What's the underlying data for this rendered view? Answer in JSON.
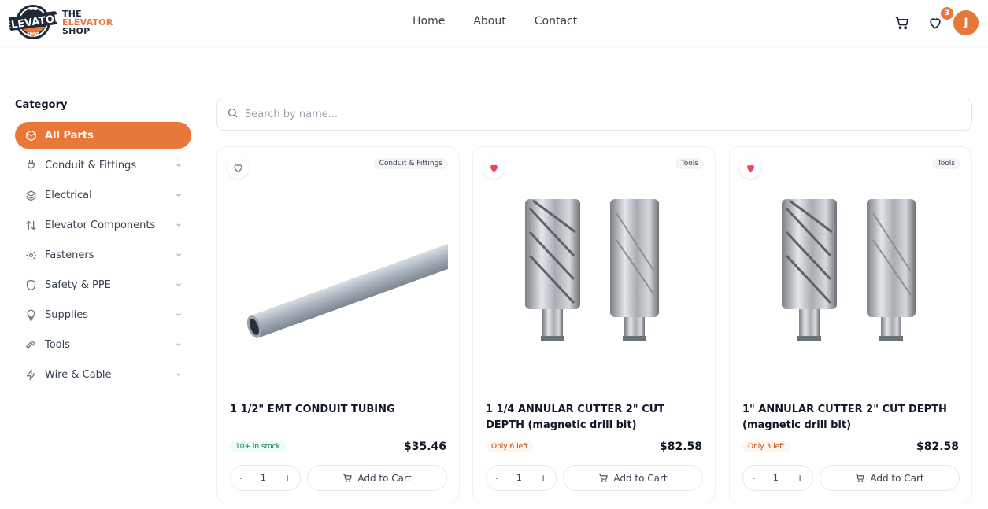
{
  "brand": {
    "line1": "THE",
    "line2": "ELEVATOR",
    "line3": "SHOP",
    "badge_text": "ELEVATOR",
    "badge_small_top": "THE",
    "badge_small_bottom": "SHOP",
    "accent": "#e8773a"
  },
  "nav": {
    "home": "Home",
    "about": "About",
    "contact": "Contact"
  },
  "header": {
    "wishlist_count": "3",
    "avatar_initial": "J"
  },
  "sidebar": {
    "title": "Category",
    "items": [
      {
        "label": "All Parts",
        "icon": "box-icon",
        "active": true
      },
      {
        "label": "Conduit & Fittings",
        "icon": "plug-icon"
      },
      {
        "label": "Electrical",
        "icon": "layers-icon"
      },
      {
        "label": "Elevator Components",
        "icon": "arrows-up-down-icon"
      },
      {
        "label": "Fasteners",
        "icon": "gear-icon"
      },
      {
        "label": "Safety & PPE",
        "icon": "shield-icon"
      },
      {
        "label": "Supplies",
        "icon": "lightbulb-icon"
      },
      {
        "label": "Tools",
        "icon": "hammer-icon"
      },
      {
        "label": "Wire & Cable",
        "icon": "bolt-icon"
      }
    ]
  },
  "search": {
    "placeholder": "Search by name..."
  },
  "products": [
    {
      "name": "1 1/2\" EMT CONDUIT TUBING",
      "tag": "Conduit & Fittings",
      "stock": "10+ in stock",
      "stock_color": "green",
      "price": "$35.46",
      "qty": "1",
      "favorited": false,
      "add_label": "Add to Cart",
      "minus": "-",
      "plus": "+"
    },
    {
      "name": "1 1/4 ANNULAR CUTTER 2\" CUT DEPTH (magnetic drill bit)",
      "tag": "Tools",
      "stock": "Only 6 left",
      "stock_color": "amber",
      "price": "$82.58",
      "qty": "1",
      "favorited": true,
      "add_label": "Add to Cart",
      "minus": "-",
      "plus": "+"
    },
    {
      "name": "1\" ANNULAR CUTTER 2\" CUT DEPTH (magnetic drill bit)",
      "tag": "Tools",
      "stock": "Only 3 left",
      "stock_color": "amber",
      "price": "$82.58",
      "qty": "1",
      "favorited": true,
      "add_label": "Add to Cart",
      "minus": "-",
      "plus": "+"
    }
  ]
}
